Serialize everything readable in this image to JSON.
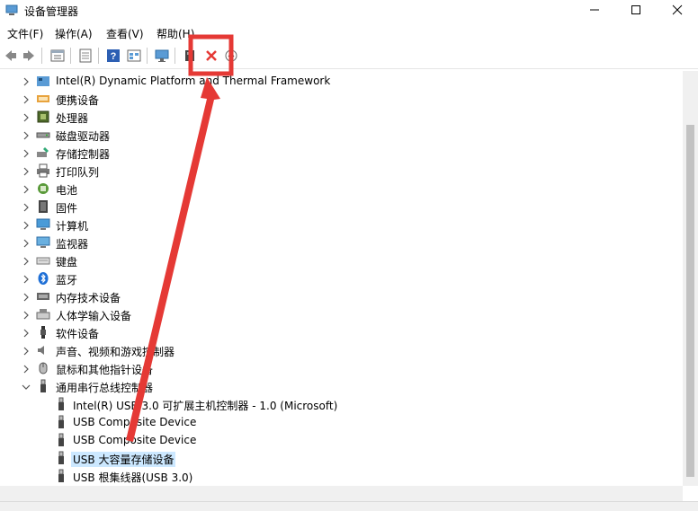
{
  "window": {
    "title": "设备管理器"
  },
  "menu": [
    "文件(F)",
    "操作(A)",
    "查看(V)",
    "帮助(H)"
  ],
  "colors": {
    "highlight": "#e53935",
    "selection": "#cce8ff"
  },
  "tree": [
    {
      "label": "Intel(R) Dynamic Platform and Thermal Framework",
      "icon": "folder-icon"
    },
    {
      "label": "便携设备",
      "icon": "portable-device-icon"
    },
    {
      "label": "处理器",
      "icon": "processor-icon"
    },
    {
      "label": "磁盘驱动器",
      "icon": "disk-drive-icon"
    },
    {
      "label": "存储控制器",
      "icon": "storage-controller-icon"
    },
    {
      "label": "打印队列",
      "icon": "printer-icon"
    },
    {
      "label": "电池",
      "icon": "battery-icon"
    },
    {
      "label": "固件",
      "icon": "firmware-icon"
    },
    {
      "label": "计算机",
      "icon": "computer-icon"
    },
    {
      "label": "监视器",
      "icon": "monitor-icon"
    },
    {
      "label": "键盘",
      "icon": "keyboard-icon"
    },
    {
      "label": "蓝牙",
      "icon": "bluetooth-icon"
    },
    {
      "label": "内存技术设备",
      "icon": "memory-icon"
    },
    {
      "label": "人体学输入设备",
      "icon": "hid-icon"
    },
    {
      "label": "软件设备",
      "icon": "software-device-icon"
    },
    {
      "label": "声音、视频和游戏控制器",
      "icon": "speaker-icon"
    },
    {
      "label": "鼠标和其他指针设备",
      "icon": "mouse-icon"
    },
    {
      "label": "通用串行总线控制器",
      "icon": "usb-icon",
      "expanded": true
    },
    {
      "label": "Intel(R) USB 3.0 可扩展主机控制器 - 1.0 (Microsoft)",
      "icon": "usb-icon",
      "child": true
    },
    {
      "label": "USB Composite Device",
      "icon": "usb-icon",
      "child": true
    },
    {
      "label": "USB Composite Device",
      "icon": "usb-icon",
      "child": true
    },
    {
      "label": "USB 大容量存储设备",
      "icon": "usb-icon",
      "child": true,
      "selected": true
    },
    {
      "label": "USB 根集线器(USB 3.0)",
      "icon": "usb-icon",
      "child": true
    }
  ]
}
